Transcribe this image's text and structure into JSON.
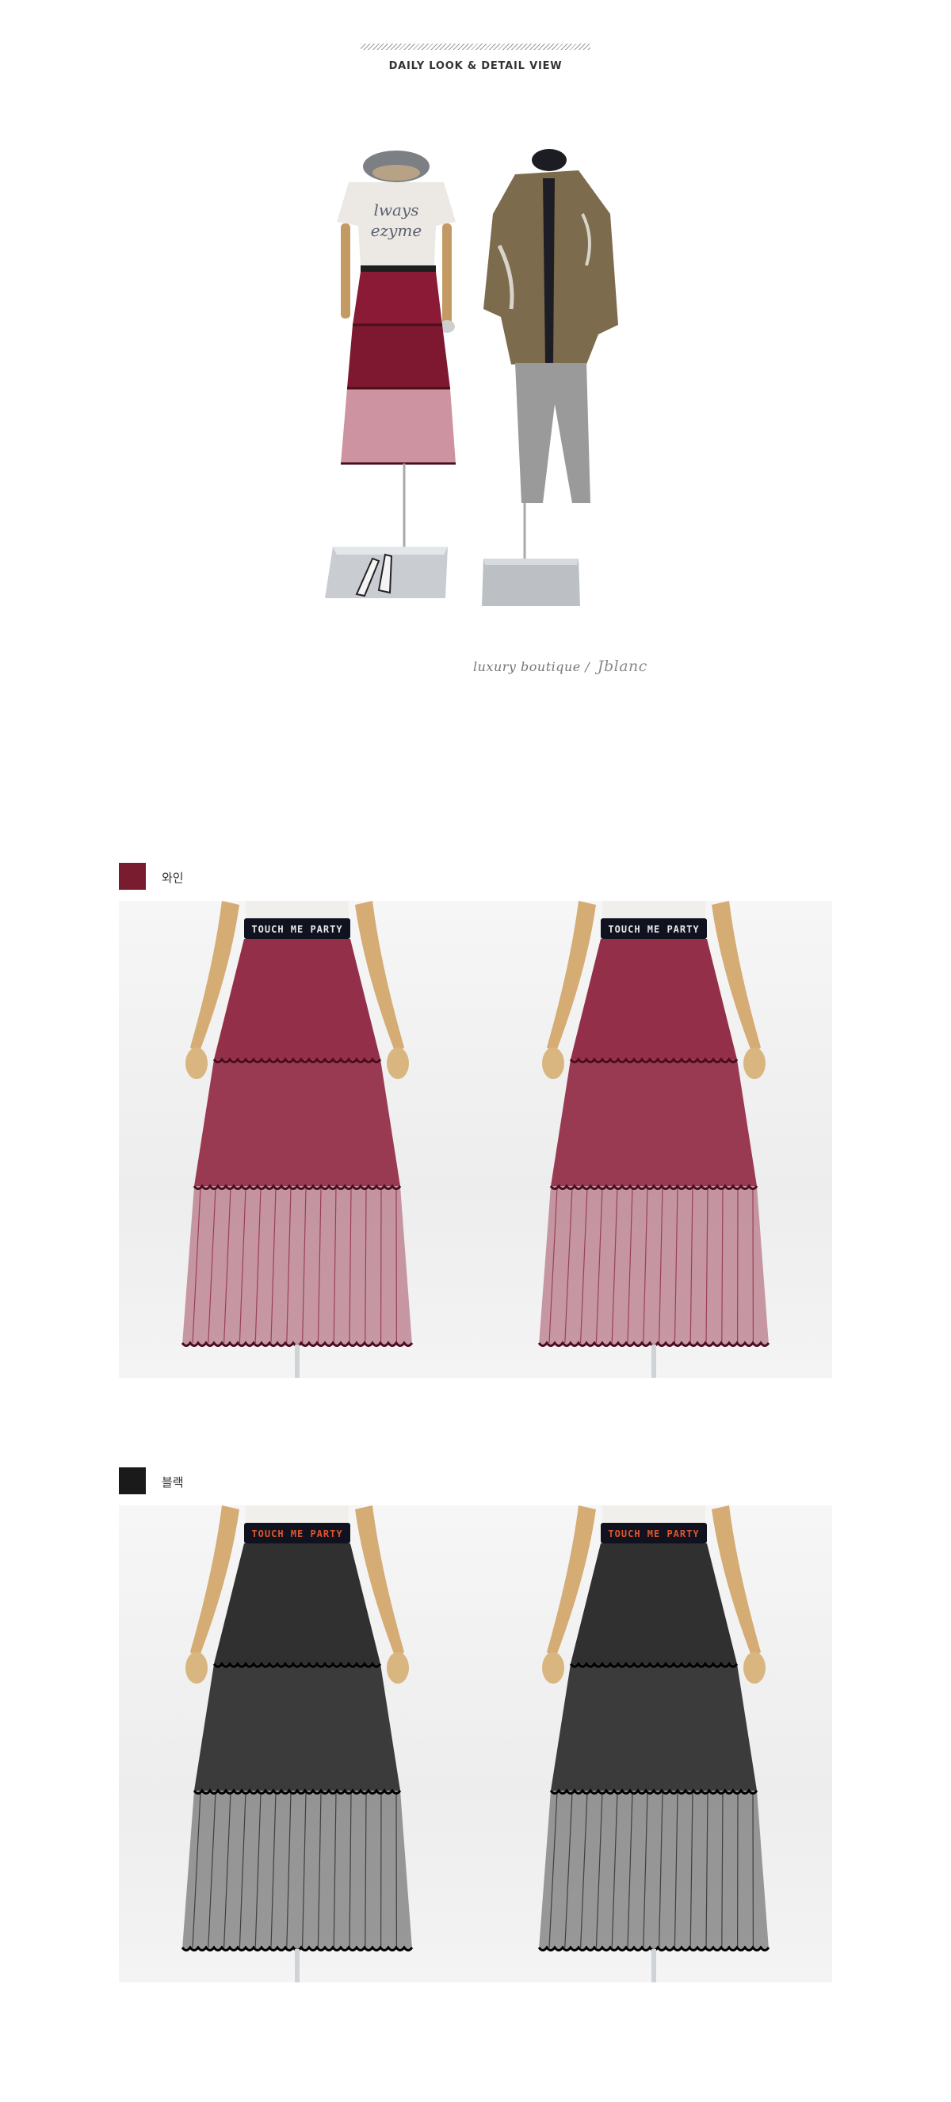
{
  "header": {
    "title": "DAILY LOOK & DETAIL VIEW"
  },
  "look": {
    "signature": "luxury boutique",
    "signature_separator": "/",
    "signature_script": "Jblanc"
  },
  "colors": [
    {
      "label": "와인",
      "swatch_color": "#7a1c30",
      "skirt_color": "#8a1a36",
      "band_text": "TOUCH ME PARTY",
      "band_text_color": "#e8e8e8"
    },
    {
      "label": "블랙",
      "swatch_color": "#1a1a1a",
      "skirt_color": "#1b1b1b",
      "band_text": "TOUCH ME PARTY",
      "band_text_color": "#e0552d"
    }
  ]
}
